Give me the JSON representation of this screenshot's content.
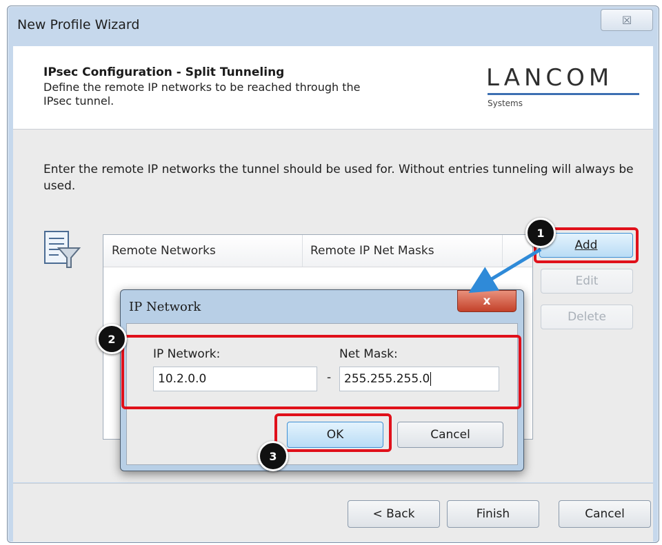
{
  "window": {
    "title": "New Profile Wizard",
    "close_glyph": "☒"
  },
  "header": {
    "title": "IPsec Configuration - Split Tunneling",
    "description": "Define the remote IP networks to be reached through the IPsec tunnel.",
    "logo": {
      "name": "LANCOM",
      "sub": "Systems"
    }
  },
  "main": {
    "instruction": "Enter the remote IP networks the tunnel should be used for. Without entries tunneling will always be used.",
    "columns": [
      "Remote Networks",
      "Remote IP Net Masks"
    ],
    "buttons": {
      "add": "Add",
      "edit": "Edit",
      "delete": "Delete"
    }
  },
  "footer": {
    "back": "< Back",
    "finish": "Finish",
    "cancel": "Cancel"
  },
  "dialog": {
    "title": "IP Network",
    "close_glyph": "x",
    "ip_label": "IP Network:",
    "ip_value": "10.2.0.0",
    "separator": "-",
    "mask_label": "Net Mask:",
    "mask_value": "255.255.255.0",
    "ok": "OK",
    "cancel": "Cancel"
  },
  "annotations": [
    "1",
    "2",
    "3"
  ],
  "colors": {
    "highlight": "#e0101a",
    "arrow": "#2f8ad8",
    "badge": "#111111"
  }
}
